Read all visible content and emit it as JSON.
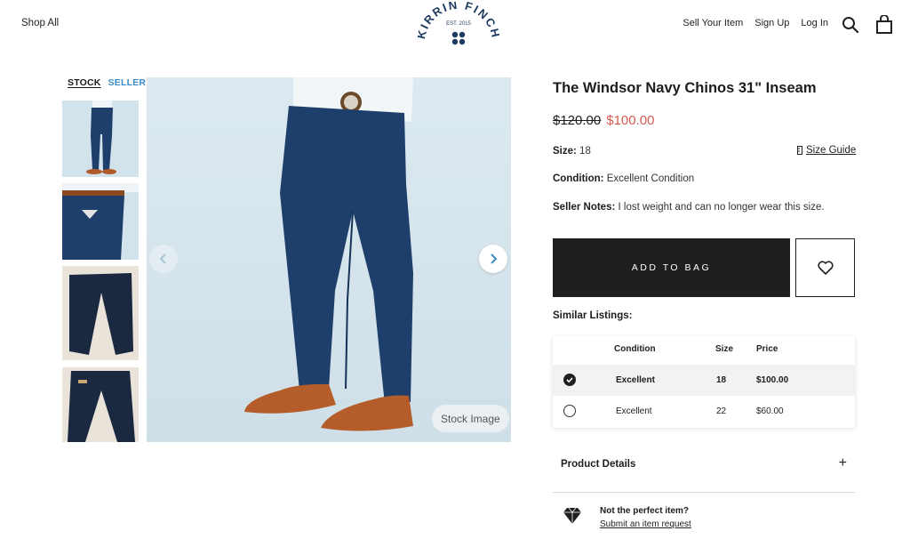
{
  "header": {
    "shop_all": "Shop All",
    "logo_text": "KIRRIN FINCH",
    "logo_est": "EST. 2015",
    "nav": [
      "Sell Your Item",
      "Sign Up",
      "Log In"
    ],
    "search_icon": "search-icon",
    "bag_icon": "bag-icon"
  },
  "gallery": {
    "tabs": {
      "stock": "STOCK",
      "seller": "SELLER"
    },
    "thumbnails": [
      "thumbnail-model-full",
      "thumbnail-back-detail",
      "thumbnail-flat-front",
      "thumbnail-flat-back"
    ],
    "badge": "Stock Image",
    "prev_icon": "chevron-left-icon",
    "next_icon": "chevron-right-icon"
  },
  "product": {
    "title": "The Windsor Navy Chinos 31\" Inseam",
    "price_old": "$120.00",
    "price_new": "$100.00",
    "size_label": "Size:",
    "size_value": "18",
    "size_guide": "Size Guide",
    "condition_label": "Condition:",
    "condition_value": "Excellent Condition",
    "notes_label": "Seller Notes:",
    "notes_value": "I lost weight and can no longer wear this size.",
    "add_to_bag": "ADD TO BAG",
    "wishlist_icon": "heart-icon"
  },
  "similar": {
    "label": "Similar Listings:",
    "headers": {
      "condition": "Condition",
      "size": "Size",
      "price": "Price"
    },
    "rows": [
      {
        "condition": "Excellent",
        "size": "18",
        "price": "$100.00",
        "selected": true
      },
      {
        "condition": "Excellent",
        "size": "22",
        "price": "$60.00",
        "selected": false
      }
    ]
  },
  "details": {
    "label": "Product Details",
    "toggle": "+"
  },
  "request": {
    "title": "Not the perfect item?",
    "link": "Submit an item request",
    "icon": "diamond-icon"
  },
  "colors": {
    "accent_blue": "#3a8cc4",
    "sale_red": "#d55a4e",
    "button_dark": "#1f1f1f",
    "navy": "#1d3a5f"
  }
}
